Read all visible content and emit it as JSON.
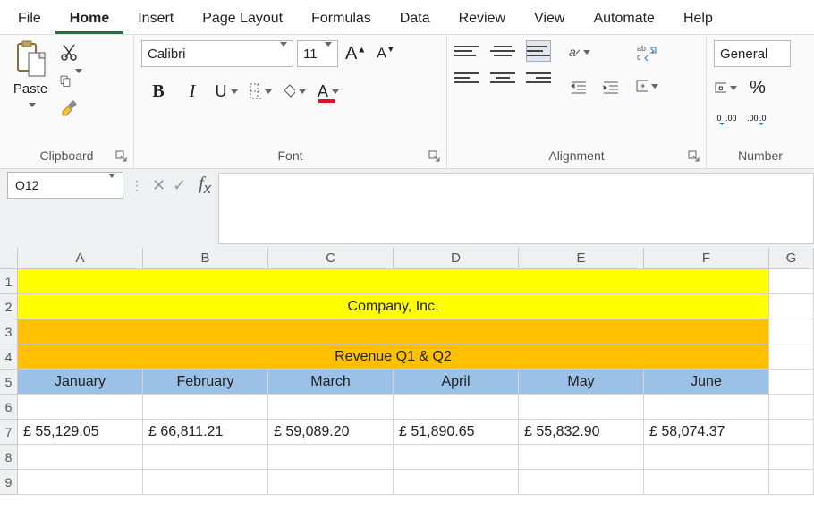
{
  "menu": [
    "File",
    "Home",
    "Insert",
    "Page Layout",
    "Formulas",
    "Data",
    "Review",
    "View",
    "Automate",
    "Help"
  ],
  "menu_active": 1,
  "ribbon": {
    "paste_label": "Paste",
    "clipboard_label": "Clipboard",
    "font_label": "Font",
    "alignment_label": "Alignment",
    "number_label": "Number",
    "font_name": "Calibri",
    "font_size": "11",
    "number_format": "General"
  },
  "namebox": "O12",
  "formula": "",
  "columns": [
    "A",
    "B",
    "C",
    "D",
    "E",
    "F",
    "G"
  ],
  "rows": [
    "1",
    "2",
    "3",
    "4",
    "5",
    "6",
    "7",
    "8",
    "9"
  ],
  "sheet": {
    "title": "Company, Inc.",
    "subtitle": "Revenue Q1 & Q2",
    "months": [
      "January",
      "February",
      "March",
      "April",
      "May",
      "June"
    ],
    "values": [
      "£ 55,129.05",
      "£ 66,811.21",
      "£ 59,089.20",
      "£ 51,890.65",
      "£ 55,832.90",
      "£ 58,074.37"
    ]
  }
}
